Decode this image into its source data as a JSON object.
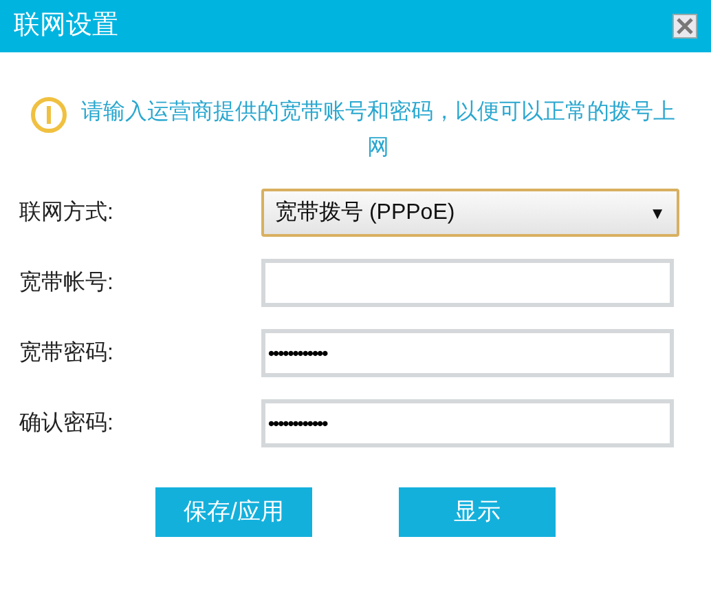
{
  "window": {
    "title": "联网设置"
  },
  "notice": "请输入运营商提供的宽带账号和密码，以便可以正常的拨号上网",
  "fields": [
    {
      "kind": "select",
      "label": "联网方式:",
      "value": "宽带拨号 (PPPoE)",
      "arrow": "▼",
      "focused": true
    },
    {
      "kind": "text",
      "label": "宽带帐号:",
      "focused": false
    },
    {
      "kind": "password",
      "label": "宽带密码:",
      "value": "••••••••••••",
      "focused": false
    },
    {
      "kind": "password",
      "label": "确认密码:",
      "value": "••••••••••••",
      "focused": false
    }
  ],
  "buttons": [
    "保存/应用",
    "显示"
  ]
}
